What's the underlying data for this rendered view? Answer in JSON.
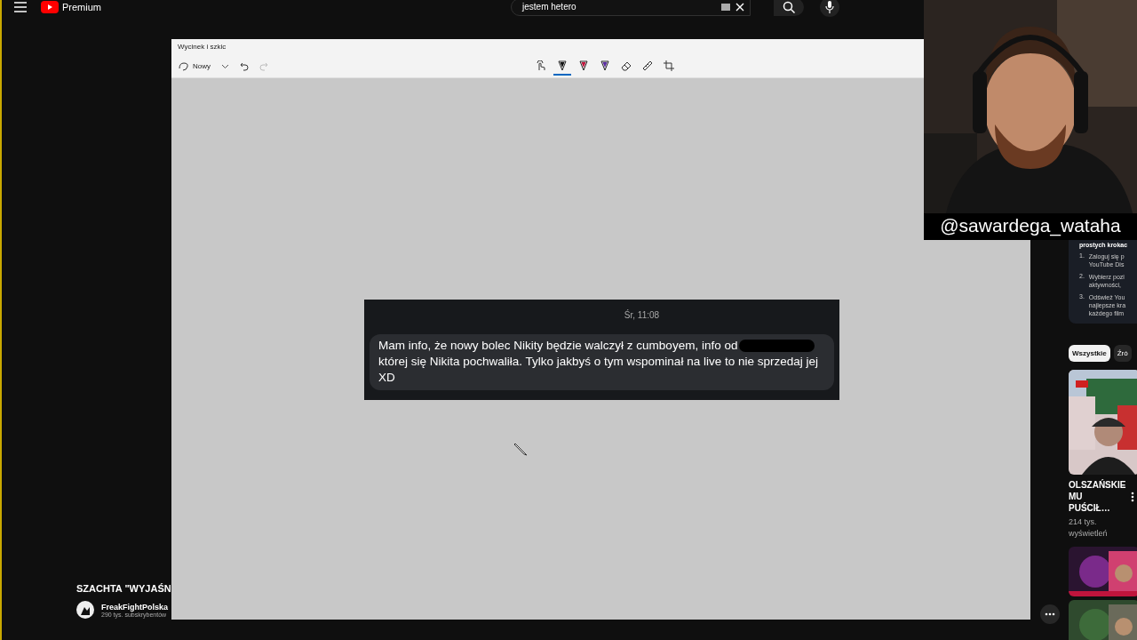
{
  "youtube": {
    "logo": "Premium",
    "search": {
      "value": "jestem hetero"
    },
    "info_card": {
      "heading": "prostych krokac",
      "steps": [
        {
          "number": "1.",
          "lines": [
            "Zaloguj się p",
            "YouTube Dis"
          ]
        },
        {
          "number": "2.",
          "lines": [
            "Wybierz pozi",
            "aktywności, "
          ]
        },
        {
          "number": "3.",
          "lines": [
            "Odśwież You",
            "najlepsze kra",
            "każdego film"
          ]
        }
      ]
    },
    "chips": [
      {
        "label": "Wszystkie",
        "selected": true
      },
      {
        "label": "Źró",
        "selected": false
      }
    ],
    "videos": [
      {
        "kind": "titled",
        "title": "OLSZAŃSKIE MU PUŚCIŁ…",
        "views": "214 tys. wyświetleń"
      },
      {
        "kind": "picture"
      },
      {
        "kind": "picture"
      }
    ],
    "now_playing": {
      "title": "SZACHTA \"WYJAŚN",
      "channel": "FreakFightPolska",
      "subscribers": "290 tys. subskrybentów"
    }
  },
  "snip": {
    "title": "Wycinek i szkic",
    "new_label": "Nowy",
    "tools": [
      {
        "kind": "touch",
        "selected": false
      },
      {
        "kind": "pen",
        "color": "#111111",
        "selected": true
      },
      {
        "kind": "pen",
        "color": "#c0143c",
        "selected": false
      },
      {
        "kind": "pen",
        "color": "#5a2ca0",
        "selected": false
      },
      {
        "kind": "eraser",
        "selected": false
      },
      {
        "kind": "ruler",
        "selected": false
      },
      {
        "kind": "crop",
        "selected": false
      }
    ],
    "message": {
      "time": "Śr, 11:08",
      "before": "Mam info, że nowy bolec Nikity będzie walczył z cumboyem, info od",
      "after": "której się Nikita pochwaliła. Tylko jakbyś o tym wspominał na live to nie sprzedaj jej XD"
    }
  },
  "webcam": {
    "handle": "@sawardega_wataha"
  }
}
